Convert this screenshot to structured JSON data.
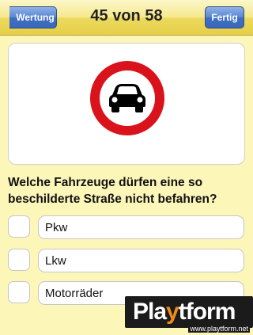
{
  "navbar": {
    "back_label": "Wertung",
    "title": "45 von 58",
    "done_label": "Fertig"
  },
  "sign": {
    "description": "no-motor-vehicles-sign-icon",
    "ring_color": "#d9121b"
  },
  "question": {
    "text": "Welche Fahrzeuge dürfen eine so beschilderte Straße nicht befahren?"
  },
  "answers": [
    {
      "label": "Pkw",
      "checked": false
    },
    {
      "label": "Lkw",
      "checked": false
    },
    {
      "label": "Motorräder",
      "checked": false
    }
  ],
  "watermark": {
    "logo_text_a": "Pla",
    "logo_text_y": "y",
    "logo_text_b": "tform",
    "url": "www.playtform.net"
  }
}
